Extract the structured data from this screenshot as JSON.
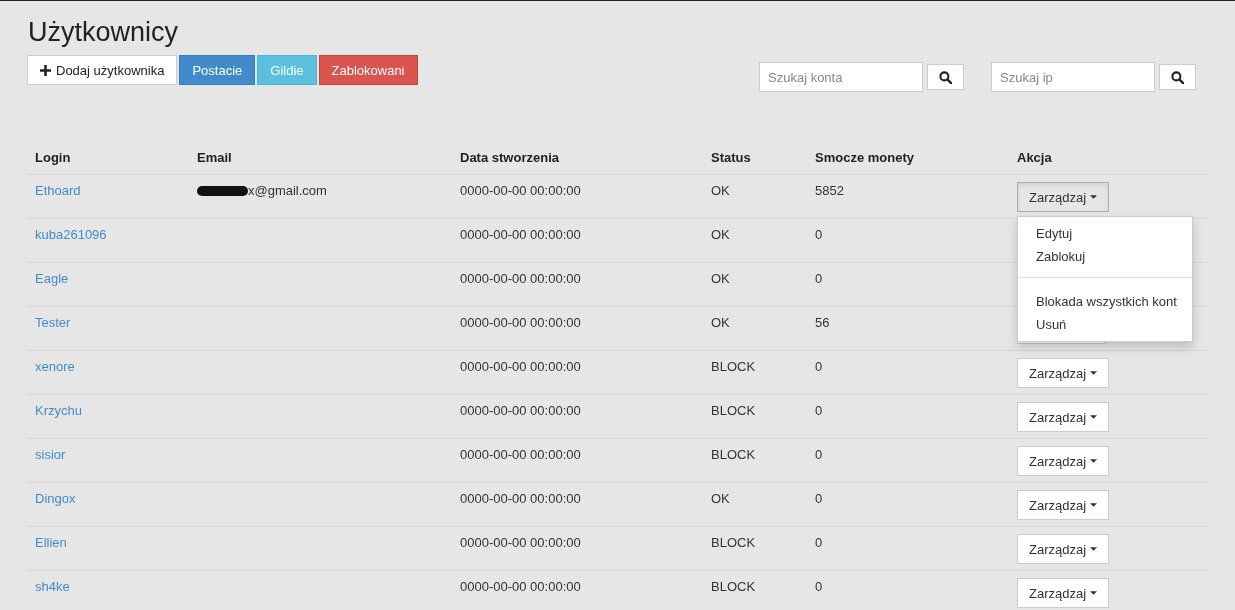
{
  "title": "Użytkownicy",
  "buttons": [
    {
      "label": "Dodaj użytkownika",
      "kind": "add"
    },
    {
      "label": "Postacie",
      "kind": "primary"
    },
    {
      "label": "Gildie",
      "kind": "info"
    },
    {
      "label": "Zablokowani",
      "kind": "danger"
    }
  ],
  "searches": [
    {
      "placeholder": "Szukaj konta"
    },
    {
      "placeholder": "Szukaj ip"
    }
  ],
  "table": {
    "columns": [
      "Login",
      "Email",
      "Data stworzenia",
      "Status",
      "Smocze monety",
      "Akcja"
    ],
    "rows": [
      {
        "login": "Ethoard",
        "email": "x@gmail.com",
        "email_redacted": true,
        "created": "0000-00-00 00:00:00",
        "status": "OK",
        "coins": "5852",
        "action": {
          "label": "Zarządzaj",
          "open": true,
          "menu": [
            {
              "label": "Edytuj",
              "kind": "item"
            },
            {
              "label": "Zablokuj",
              "kind": "item"
            },
            {
              "kind": "divider"
            },
            {
              "label": "Blokada wszystkich kont",
              "kind": "item"
            },
            {
              "label": "Usuń",
              "kind": "item"
            }
          ]
        }
      },
      {
        "login": "kuba261096",
        "created": "0000-00-00 00:00:00",
        "status": "OK",
        "coins": "0"
      },
      {
        "login": "Eagle",
        "created": "0000-00-00 00:00:00",
        "status": "OK",
        "coins": "0"
      },
      {
        "login": "Tester",
        "created": "0000-00-00 00:00:00",
        "status": "OK",
        "coins": "56",
        "action": {
          "open": false
        }
      },
      {
        "login": "xenore",
        "created": "0000-00-00 00:00:00",
        "status": "BLOCK",
        "coins": "0",
        "action": {
          "label": "Zarządzaj",
          "open": false
        }
      },
      {
        "login": "Krzychu",
        "created": "0000-00-00 00:00:00",
        "status": "BLOCK",
        "coins": "0",
        "action": {
          "label": "Zarządzaj",
          "open": false
        }
      },
      {
        "login": "sisior",
        "created": "0000-00-00 00:00:00",
        "status": "BLOCK",
        "coins": "0",
        "action": {
          "label": "Zarządzaj",
          "open": false
        }
      },
      {
        "login": "Dingox",
        "created": "0000-00-00 00:00:00",
        "status": "OK",
        "coins": "0",
        "action": {
          "label": "Zarządzaj",
          "open": false
        }
      },
      {
        "login": "Ellien",
        "created": "0000-00-00 00:00:00",
        "status": "BLOCK",
        "coins": "0",
        "action": {
          "label": "Zarządzaj",
          "open": false
        }
      },
      {
        "login": "sh4ke",
        "created": "0000-00-00 00:00:00",
        "status": "BLOCK",
        "coins": "0",
        "action": {
          "label": "Zarządzaj",
          "open": false
        }
      }
    ]
  }
}
